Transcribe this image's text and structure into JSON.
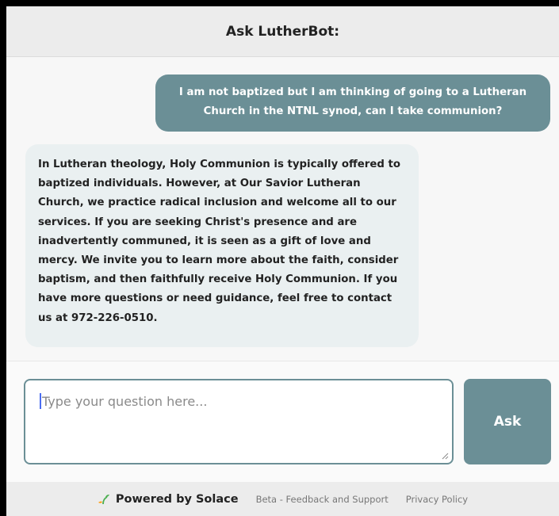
{
  "header": {
    "title": "Ask LutherBot:"
  },
  "messages": {
    "user": "I am not baptized but I am thinking of going to a Lutheran Church in the NTNL synod, can I take communion?",
    "bot": "In Lutheran theology, Holy Communion is typically offered to baptized individuals. However, at Our Savior Lutheran Church, we practice radical inclusion and welcome all to our services. If you are seeking Christ's presence and are inadvertently communed, it is seen as a gift of love and mercy. We invite you to learn more about the faith, consider baptism, and then faithfully receive Holy Communion. If you have more questions or need guidance, feel free to contact us at 972-226-0510."
  },
  "input": {
    "placeholder": "Type your question here...",
    "value": ""
  },
  "ask_button": {
    "label": "Ask"
  },
  "footer": {
    "powered_by": "Powered by Solace",
    "links": [
      "Beta - Feedback and Support",
      "Privacy Policy"
    ]
  },
  "colors": {
    "accent": "#6b8f96",
    "bot_bubble": "#eaf0f1",
    "sprout_icon": "#4caf50"
  }
}
